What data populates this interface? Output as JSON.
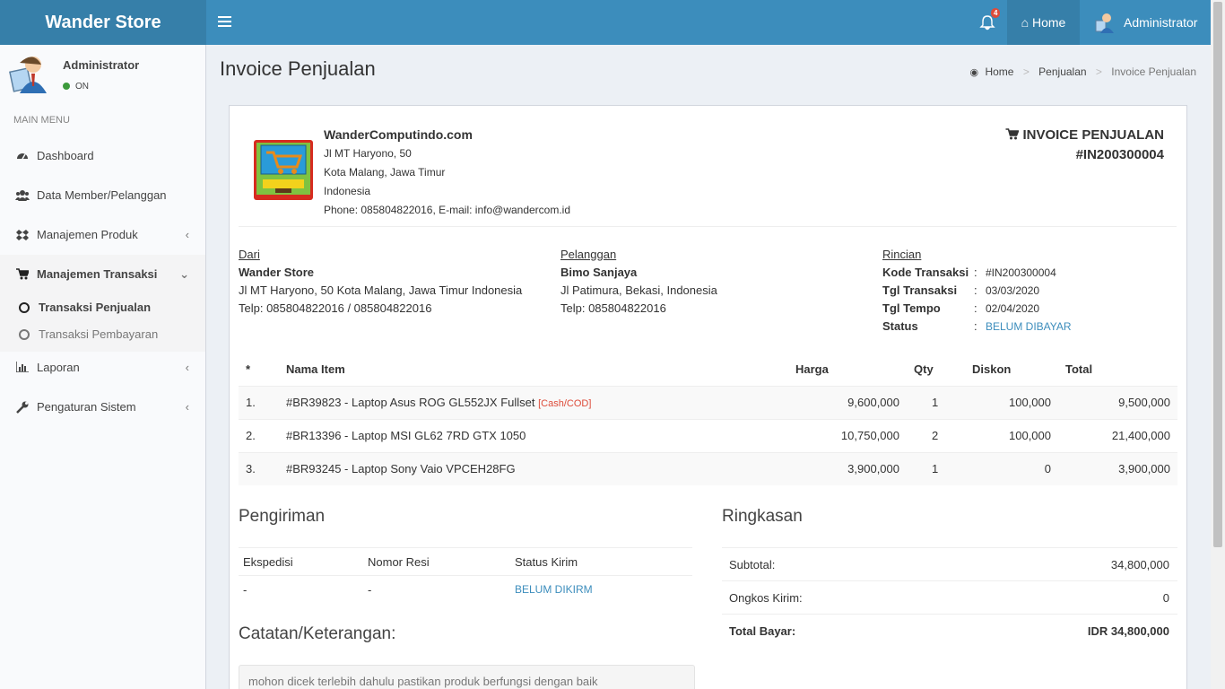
{
  "header": {
    "brand": "Wander Store",
    "notif_count": "4",
    "home_label": "Home",
    "user_label": "Administrator"
  },
  "sidebar": {
    "user_name": "Administrator",
    "status": "ON",
    "menu_header": "MAIN MENU",
    "items": [
      {
        "label": "Dashboard",
        "icon": "dashboard-icon"
      },
      {
        "label": "Data Member/Pelanggan",
        "icon": "users-icon"
      },
      {
        "label": "Manajemen Produk",
        "icon": "dropbox-icon"
      },
      {
        "label": "Manajemen Transaksi",
        "icon": "cart-icon"
      },
      {
        "label": "Laporan",
        "icon": "bar-chart-icon"
      },
      {
        "label": "Pengaturan Sistem",
        "icon": "wrench-icon"
      }
    ],
    "subitems": [
      {
        "label": "Transaksi Penjualan"
      },
      {
        "label": "Transaksi Pembayaran"
      }
    ]
  },
  "page": {
    "title": "Invoice Penjualan",
    "breadcrumb": [
      "Home",
      "Penjualan",
      "Invoice Penjualan"
    ]
  },
  "company": {
    "name": "WanderComputindo.com",
    "address1": "Jl MT Haryono, 50",
    "address2": "Kota Malang, Jawa Timur",
    "country": "Indonesia",
    "contact": "Phone: 085804822016, E-mail: info@wandercom.id"
  },
  "invoice": {
    "title": "INVOICE PENJUALAN",
    "number": "#IN200300004"
  },
  "from": {
    "heading": "Dari",
    "name": "Wander Store",
    "address": "Jl MT Haryono, 50 Kota Malang, Jawa Timur Indonesia",
    "phone": "Telp: 085804822016 / 085804822016"
  },
  "customer": {
    "heading": "Pelanggan",
    "name": "Bimo Sanjaya",
    "address": "Jl Patimura, Bekasi, Indonesia",
    "phone": "Telp: 085804822016"
  },
  "details": {
    "heading": "Rincian",
    "rows": [
      {
        "label": "Kode Transaksi",
        "colon": ":",
        "value": "#IN200300004"
      },
      {
        "label": "Tgl Transaksi",
        "colon": ":",
        "value": "03/03/2020"
      },
      {
        "label": "Tgl Tempo",
        "colon": ":",
        "value": "02/04/2020"
      },
      {
        "label": "Status",
        "colon": ":",
        "value": "BELUM DIBAYAR"
      }
    ]
  },
  "items_table": {
    "headers": [
      "*",
      "Nama Item",
      "Harga",
      "Qty",
      "Diskon",
      "Total"
    ],
    "rows": [
      {
        "no": "1.",
        "name": "#BR39823 - Laptop Asus ROG GL552JX Fullset",
        "tag": "[Cash/COD]",
        "price": "9,600,000",
        "qty": "1",
        "discount": "100,000",
        "total": "9,500,000"
      },
      {
        "no": "2.",
        "name": "#BR13396 - Laptop MSI GL62 7RD GTX 1050",
        "tag": "",
        "price": "10,750,000",
        "qty": "2",
        "discount": "100,000",
        "total": "21,400,000"
      },
      {
        "no": "3.",
        "name": "#BR93245 - Laptop Sony Vaio VPCEH28FG",
        "tag": "",
        "price": "3,900,000",
        "qty": "1",
        "discount": "0",
        "total": "3,900,000"
      }
    ]
  },
  "shipping": {
    "title": "Pengiriman",
    "headers": [
      "Ekspedisi",
      "Nomor Resi",
      "Status Kirim"
    ],
    "row": [
      "-",
      "-",
      "BELUM DIKIRM"
    ]
  },
  "summary": {
    "title": "Ringkasan",
    "rows": [
      {
        "label": "Subtotal:",
        "value": "34,800,000"
      },
      {
        "label": "Ongkos Kirim:",
        "value": "0"
      },
      {
        "label": "Total Bayar:",
        "value": "IDR 34,800,000"
      }
    ]
  },
  "notes": {
    "title": "Catatan/Keterangan:",
    "text": "mohon dicek terlebih dahulu pastikan produk berfungsi dengan baik"
  }
}
